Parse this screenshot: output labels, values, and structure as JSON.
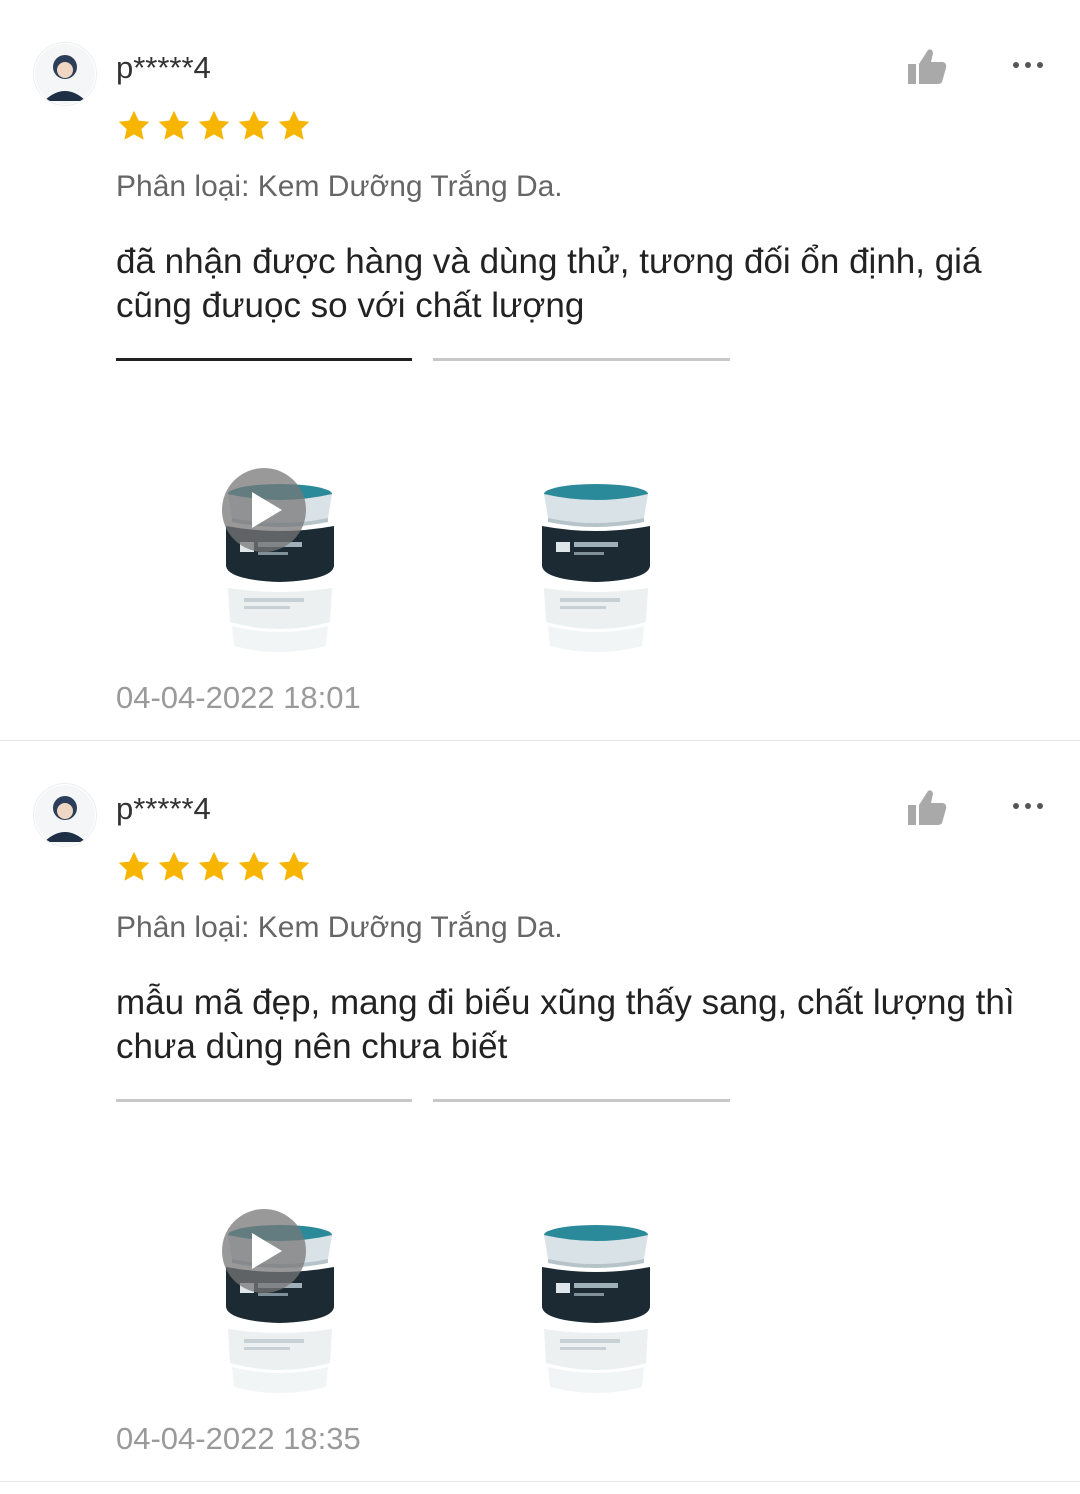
{
  "reviews": [
    {
      "username": "p*****4",
      "rating": 5,
      "variant": "Phân loại: Kem Dưỡng Trắng Da.",
      "comment": "đã nhận được hàng và dùng thử, tương đối ổn định, giá cũng đưuọc so với chất lượng",
      "timestamp": "04-04-2022 18:01",
      "media": [
        "video",
        "image"
      ]
    },
    {
      "username": "p*****4",
      "rating": 5,
      "variant": "Phân loại: Kem Dưỡng Trắng Da.",
      "comment": "mẫu mã đẹp, mang đi biếu xũng thấy sang, chất lượng thì chưa dùng nên chưa biết",
      "timestamp": "04-04-2022 18:35",
      "media": [
        "video",
        "image"
      ]
    }
  ],
  "icons": {
    "like": "thumbs-up-icon",
    "more": "more-dots-icon",
    "star": "star-icon",
    "play": "play-icon"
  },
  "colors": {
    "star": "#f7b500",
    "icon": "#a9a9a9",
    "timestamp": "#9a9a9a",
    "jar_cap": "#2b8a9a",
    "jar_body": "#1b2a33"
  }
}
